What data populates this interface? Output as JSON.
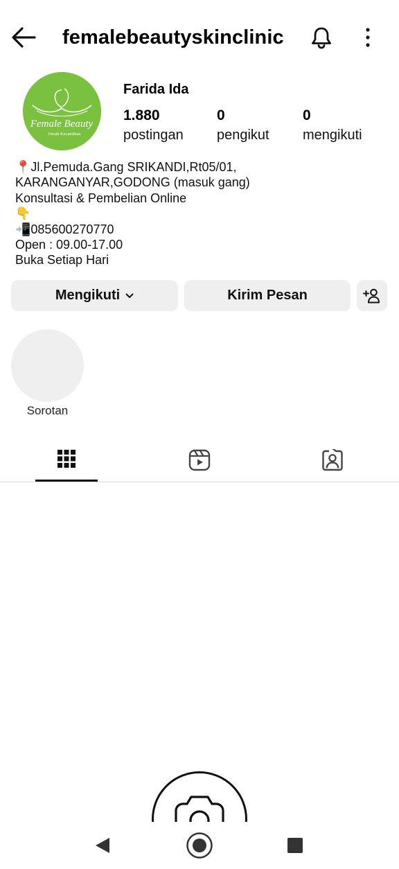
{
  "header": {
    "username": "femalebeautyskinclinic",
    "icons": {
      "back": "arrow-left-icon",
      "notifications": "bell-icon",
      "more": "more-vertical-icon"
    }
  },
  "profile": {
    "display_name": "Farida Ida",
    "avatar_logo": {
      "line1": "Female Beauty",
      "line2": "Omah Kecantikan",
      "bg_color": "#7ac13f"
    },
    "stats": [
      {
        "count": "1.880",
        "label": "postingan"
      },
      {
        "count": "0",
        "label": "pengikut"
      },
      {
        "count": "0",
        "label": "mengikuti"
      }
    ]
  },
  "bio": {
    "lines": [
      "📍Jl.Pemuda.Gang SRIKANDI,Rt05/01,",
      "KARANGANYAR,GODONG (masuk gang)",
      "Konsultasi & Pembelian Online",
      " 👇",
      "📲085600270770",
      "Open : 09.00-17.00",
      "Buka Setiap Hari"
    ]
  },
  "actions": {
    "follow_label": "Mengikuti",
    "message_label": "Kirim Pesan",
    "add_user_icon": "add-person-icon"
  },
  "highlights": [
    {
      "label": "Sorotan"
    }
  ],
  "tabs": [
    {
      "name": "posts-grid",
      "icon": "grid-icon",
      "active": true
    },
    {
      "name": "reels",
      "icon": "reels-icon",
      "active": false
    },
    {
      "name": "tagged",
      "icon": "tagged-person-icon",
      "active": false
    }
  ],
  "system_nav": {
    "icons": [
      "nav-back-icon",
      "nav-home-icon",
      "nav-recent-icon"
    ]
  }
}
